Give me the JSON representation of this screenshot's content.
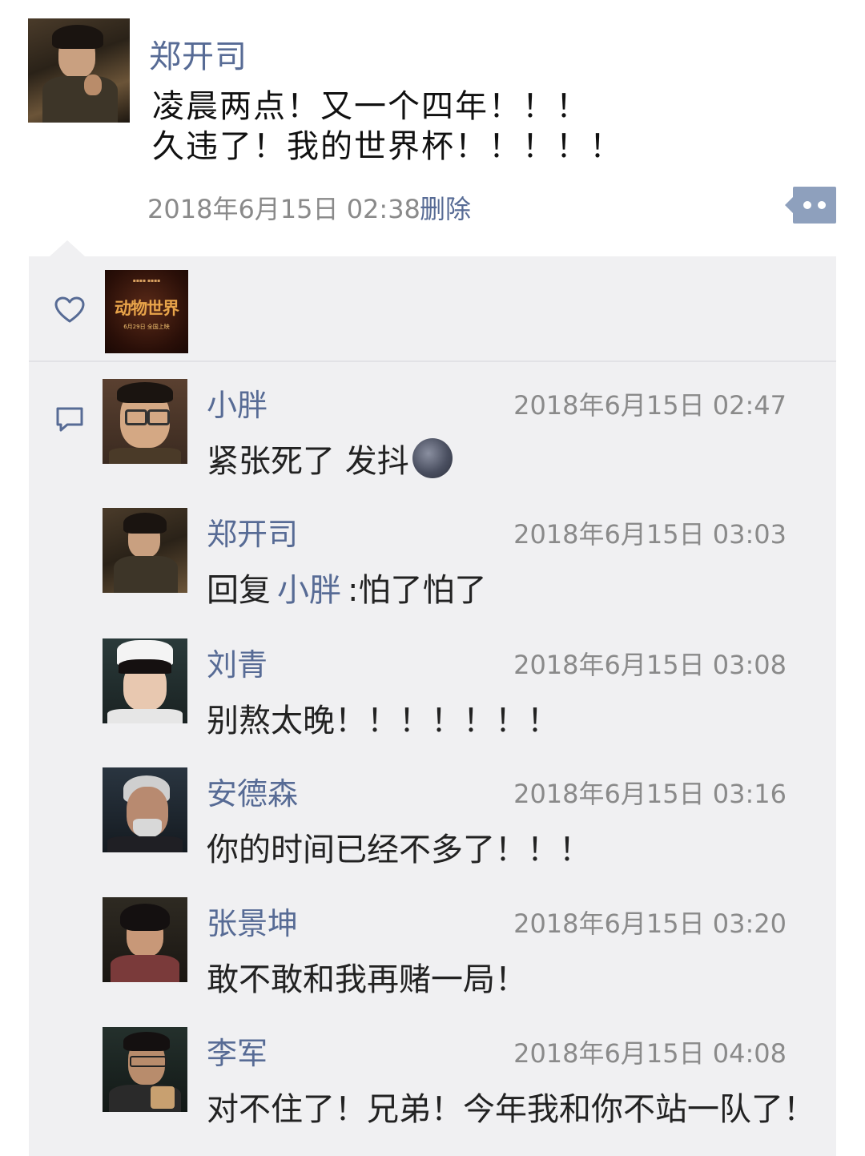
{
  "post": {
    "author": "郑开司",
    "line1": "凌晨两点！又一个四年！！！",
    "line2": "久违了！我的世界杯！！！！！",
    "time": "2018年6月15日 02:38",
    "delete_label": "删除"
  },
  "likes": {
    "poster_title": "动物世界",
    "poster_sub": "6月29日 全国上映"
  },
  "comments": [
    {
      "name": "小胖",
      "time": "2018年6月15日 02:47",
      "text": "紧张死了 发抖"
    },
    {
      "name": "郑开司",
      "time": "2018年6月15日 03:03",
      "prefix": "回复",
      "reply_to": "小胖",
      "text": ":怕了怕了"
    },
    {
      "name": "刘青",
      "time": "2018年6月15日 03:08",
      "text": "别熬太晚！！！！！！！"
    },
    {
      "name": "安德森",
      "time": "2018年6月15日 03:16",
      "text": "你的时间已经不多了！！！"
    },
    {
      "name": "张景坤",
      "time": "2018年6月15日 03:20",
      "text": "敢不敢和我再赌一局！"
    },
    {
      "name": "李军",
      "time": "2018年6月15日 04:08",
      "text": "对不住了！兄弟！今年我和你不站一队了！"
    }
  ],
  "colors": {
    "link": "#576b95",
    "panel": "#f0f0f2"
  },
  "icons": {
    "like": "heart-icon",
    "comment": "comment-icon",
    "more": "more-dots-icon",
    "emoji": "new-moon-face-emoji"
  }
}
